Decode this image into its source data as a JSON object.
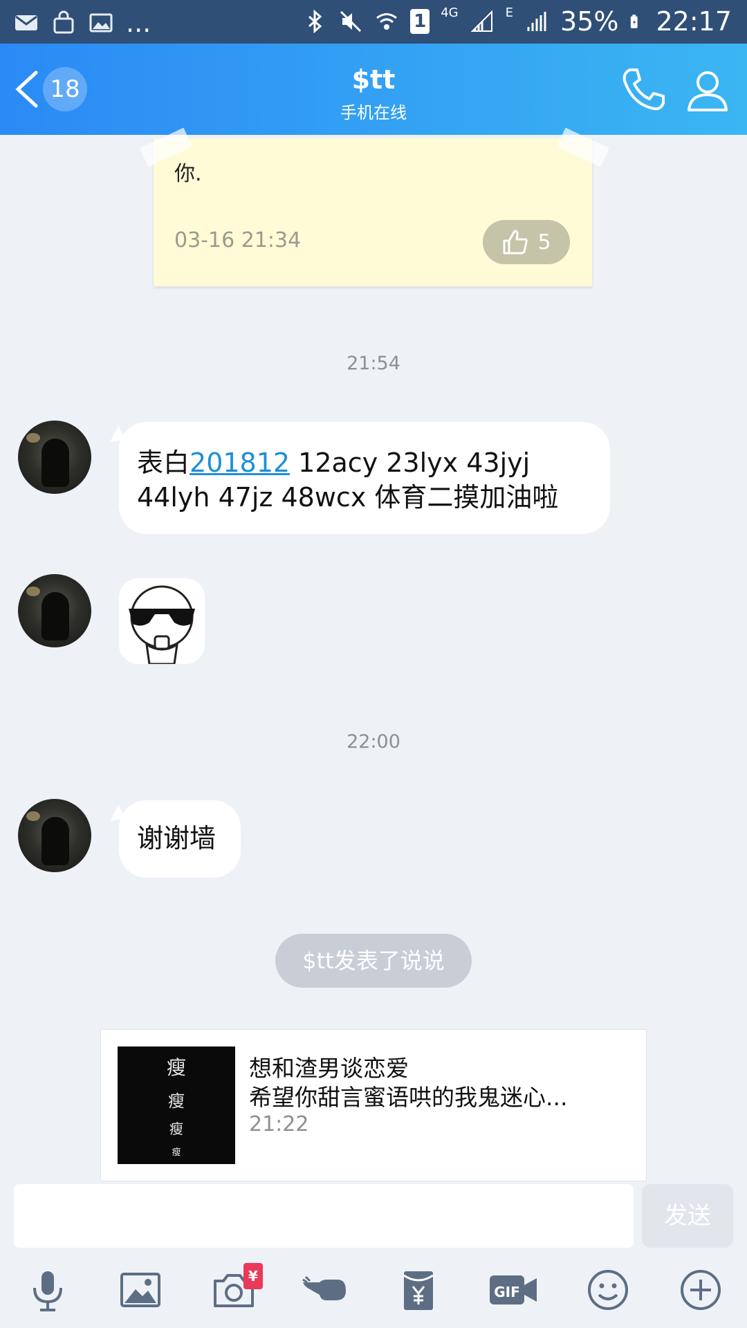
{
  "status_bar": {
    "left_ellipsis": "...",
    "sim_badge": "1",
    "network_4g": "4G",
    "network_e": "E",
    "battery_percent": "35%",
    "clock": "22:17",
    "icons": [
      "mail-icon",
      "bag-icon",
      "image-icon",
      "bluetooth-icon",
      "mute-icon",
      "wifi-icon",
      "signal-icon",
      "battery-icon"
    ]
  },
  "header": {
    "unread_count": "18",
    "title": "$tt",
    "subtitle": "手机在线",
    "accent_start": "#2b8af5",
    "accent_end": "#3bb6f2"
  },
  "note_card": {
    "text": "你.",
    "time": "03-16 21:34",
    "like_count": "5"
  },
  "messages": {
    "timestamp_1": "21:54",
    "msg_1_prefix": "表白",
    "msg_1_link": "201812",
    "msg_1_line1_rest": " 12acy 23lyx 43jyj",
    "msg_1_line2": "44lyh 47jz 48wcx  体育二摸加油啦",
    "timestamp_2": "22:00",
    "msg_3": "谢谢墙"
  },
  "system": {
    "notice": "$tt发表了说说"
  },
  "share_card": {
    "thumb_chars": [
      "瘦",
      "瘦",
      "瘦",
      "瘦"
    ],
    "title": "想和渣男谈恋爱",
    "description": "希望你甜言蜜语哄的我鬼迷心...",
    "time": "21:22"
  },
  "composer": {
    "input_value": "",
    "send_label": "发送"
  },
  "toolbar": {
    "yen_badge": "¥",
    "items": [
      "microphone-icon",
      "image-icon",
      "camera-icon",
      "poke-hand-icon",
      "red-packet-icon",
      "gif-icon",
      "emoji-icon",
      "plus-icon"
    ]
  }
}
